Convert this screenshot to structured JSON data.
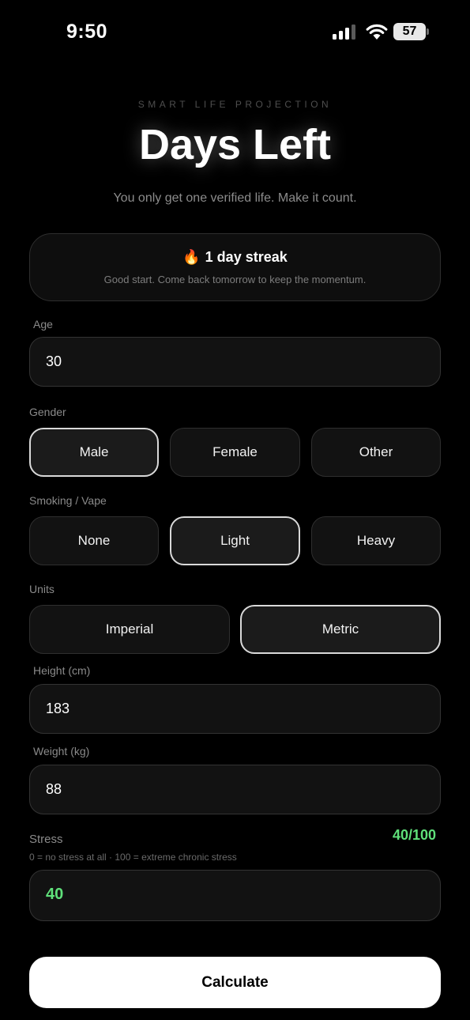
{
  "status_bar": {
    "time": "9:50",
    "battery": "57"
  },
  "header": {
    "kicker": "SMART LIFE PROJECTION",
    "title": "Days Left",
    "tagline": "You only get one verified life. Make it count."
  },
  "streak": {
    "emoji": "🔥",
    "title": "1 day streak",
    "subtitle": "Good start. Come back tomorrow to keep the momentum."
  },
  "age": {
    "label": "Age",
    "value": "30"
  },
  "gender": {
    "label": "Gender",
    "options": [
      "Male",
      "Female",
      "Other"
    ],
    "selected": "Male"
  },
  "smoking": {
    "label": "Smoking / Vape",
    "options": [
      "None",
      "Light",
      "Heavy"
    ],
    "selected": "Light"
  },
  "units": {
    "label": "Units",
    "options": [
      "Imperial",
      "Metric"
    ],
    "selected": "Metric"
  },
  "height": {
    "label": "Height (cm)",
    "value": "183"
  },
  "weight": {
    "label": "Weight (kg)",
    "value": "88"
  },
  "stress": {
    "label": "Stress",
    "hint": "0 = no stress at all · 100 = extreme chronic stress",
    "readout": "40/100",
    "value": "40",
    "accent": "#5fe07a"
  },
  "calculate_label": "Calculate"
}
